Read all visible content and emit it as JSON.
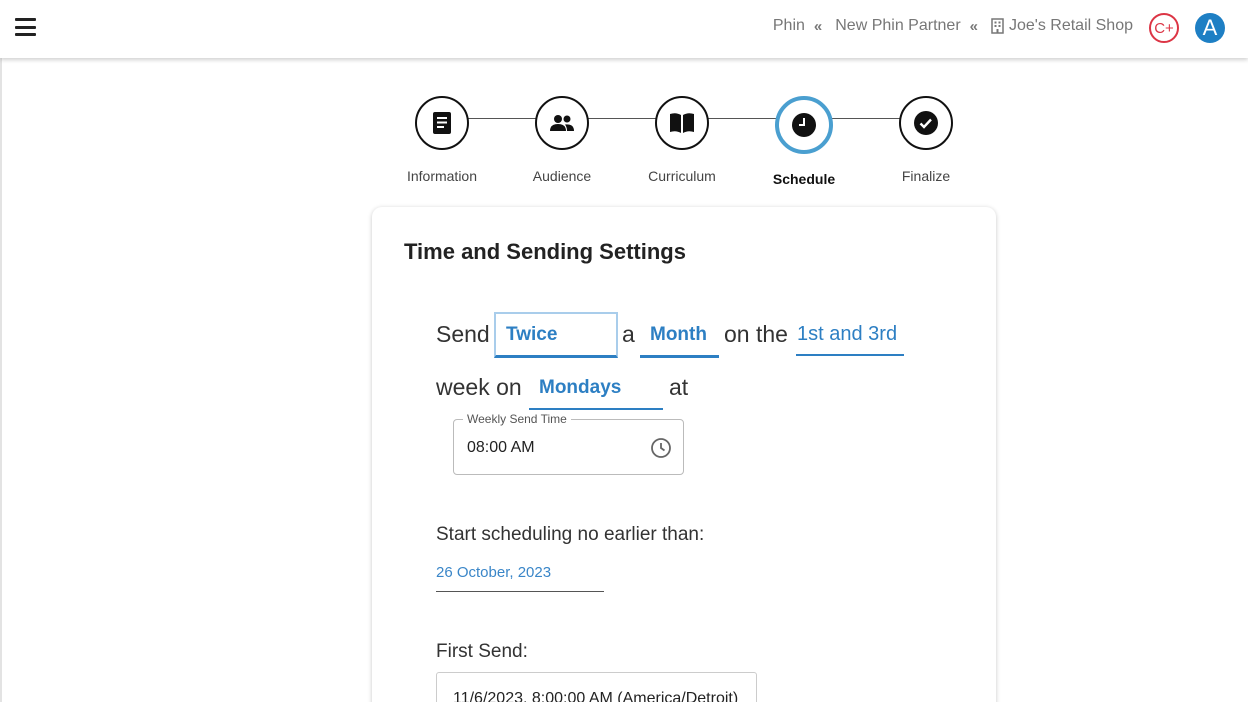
{
  "header": {
    "breadcrumbs": [
      "Phin",
      "New Phin Partner",
      "Joe's Retail Shop"
    ],
    "badge_label": "C+",
    "avatar_initial": "A",
    "colors": {
      "badge": "#dc3545",
      "avatar": "#1e7fc4"
    }
  },
  "stepper": {
    "steps": [
      {
        "label": "Information",
        "icon": "document-icon"
      },
      {
        "label": "Audience",
        "icon": "people-icon"
      },
      {
        "label": "Curriculum",
        "icon": "book-icon"
      },
      {
        "label": "Schedule",
        "icon": "clock-icon",
        "active": true
      },
      {
        "label": "Finalize",
        "icon": "check-circle-icon"
      }
    ],
    "active_color": "#4a9fd0"
  },
  "card": {
    "title": "Time and Sending Settings",
    "sentence": {
      "send": "Send",
      "frequency": "Twice",
      "a": "a",
      "period": "Month",
      "on_the": "on the",
      "weeks": "1st and 3rd",
      "week_on": "week on",
      "day": "Mondays",
      "at": "at"
    },
    "weekly_send_time": {
      "label": "Weekly Send Time",
      "value": "08:00 AM"
    },
    "start": {
      "label": "Start scheduling no earlier than:",
      "value": "26 October, 2023"
    },
    "first_send": {
      "label": "First Send:",
      "value": "11/6/2023, 8:00:00 AM (America/Detroit)"
    },
    "accent_color": "#2d7fc3"
  }
}
